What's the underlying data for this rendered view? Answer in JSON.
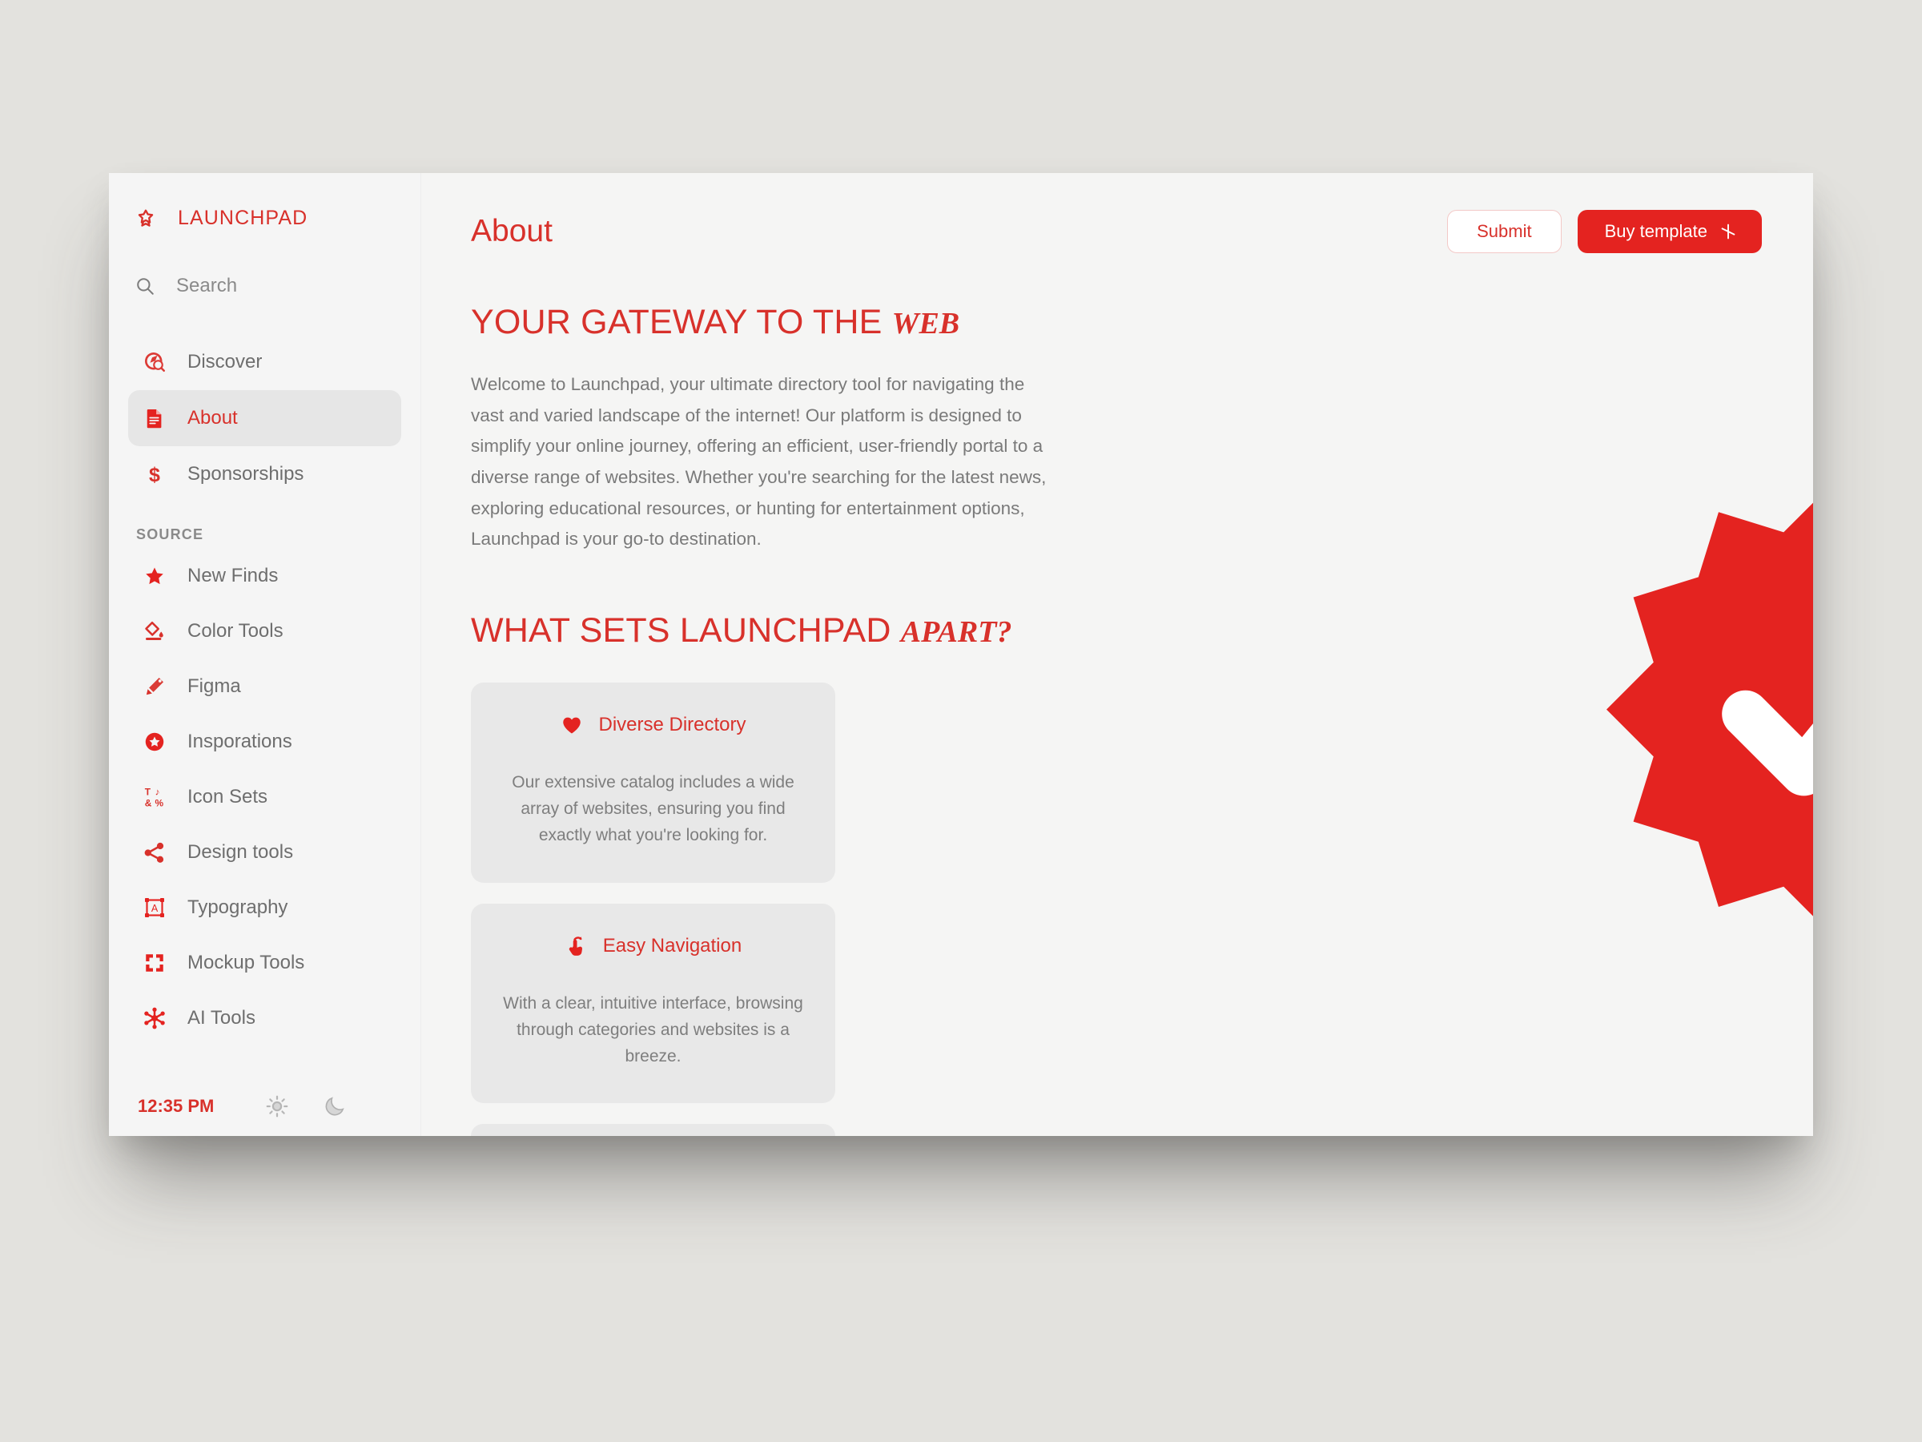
{
  "brand": {
    "name": "LAUNCHPAD",
    "icon": "star-badge-icon"
  },
  "search": {
    "placeholder": "Search",
    "value": "",
    "icon": "search-icon"
  },
  "nav": {
    "items": [
      {
        "label": "Discover",
        "icon": "compass-search-icon",
        "active": false
      },
      {
        "label": "About",
        "icon": "document-icon",
        "active": true
      },
      {
        "label": "Sponsorships",
        "icon": "dollar-icon",
        "active": false
      }
    ]
  },
  "source": {
    "label": "SOURCE",
    "items": [
      {
        "label": "New Finds",
        "icon": "star-icon"
      },
      {
        "label": "Color Tools",
        "icon": "paint-bucket-icon"
      },
      {
        "label": "Figma",
        "icon": "figma-icon"
      },
      {
        "label": "Insporations",
        "icon": "star-circle-icon"
      },
      {
        "label": "Icon Sets",
        "icon": "glyph-grid-icon"
      },
      {
        "label": "Design tools",
        "icon": "share-node-icon"
      },
      {
        "label": "Typography",
        "icon": "type-frame-icon"
      },
      {
        "label": "Mockup Tools",
        "icon": "corner-frame-icon"
      },
      {
        "label": "AI Tools",
        "icon": "ai-node-icon"
      }
    ]
  },
  "footer": {
    "time": "12:35 PM",
    "light_toggle_icon": "sun-icon",
    "dark_toggle_icon": "moon-icon"
  },
  "header": {
    "title": "About",
    "submit_label": "Submit",
    "buy_label": "Buy template",
    "buy_icon": "sparkle-icon"
  },
  "main": {
    "heading1_plain": "YOUR GATEWAY TO THE ",
    "heading1_italic": "WEB",
    "intro": "Welcome to Launchpad, your ultimate directory tool for navigating the vast and varied landscape of the internet! Our platform is designed to simplify your online journey, offering an efficient, user-friendly portal to a diverse range of websites. Whether you're searching for the latest news, exploring educational resources, or hunting for entertainment options, Launchpad is your go-to destination.",
    "heading2_plain": "WHAT SETS LAUNCHPAD ",
    "heading2_italic": "APART?",
    "cards": [
      {
        "title": "Diverse Directory",
        "icon": "heart-icon",
        "body": "Our extensive catalog includes a wide array of websites, ensuring you find exactly what you're looking for."
      },
      {
        "title": "Easy Navigation",
        "icon": "tap-gesture-icon",
        "body": "With a clear, intuitive interface, browsing through categories and websites is a breeze."
      }
    ]
  },
  "hero": {
    "icon": "verified-check-badge-icon"
  },
  "colors": {
    "accent": "#E42320",
    "accent_text": "#D8312B",
    "page_background": "#E3E2DE",
    "window_background": "#F5F5F4",
    "sidebar_background": "#F5F5F5",
    "card_background": "#E8E8E8",
    "active_item_background": "#E6E6E6",
    "muted_text": "#7A7A7A"
  }
}
